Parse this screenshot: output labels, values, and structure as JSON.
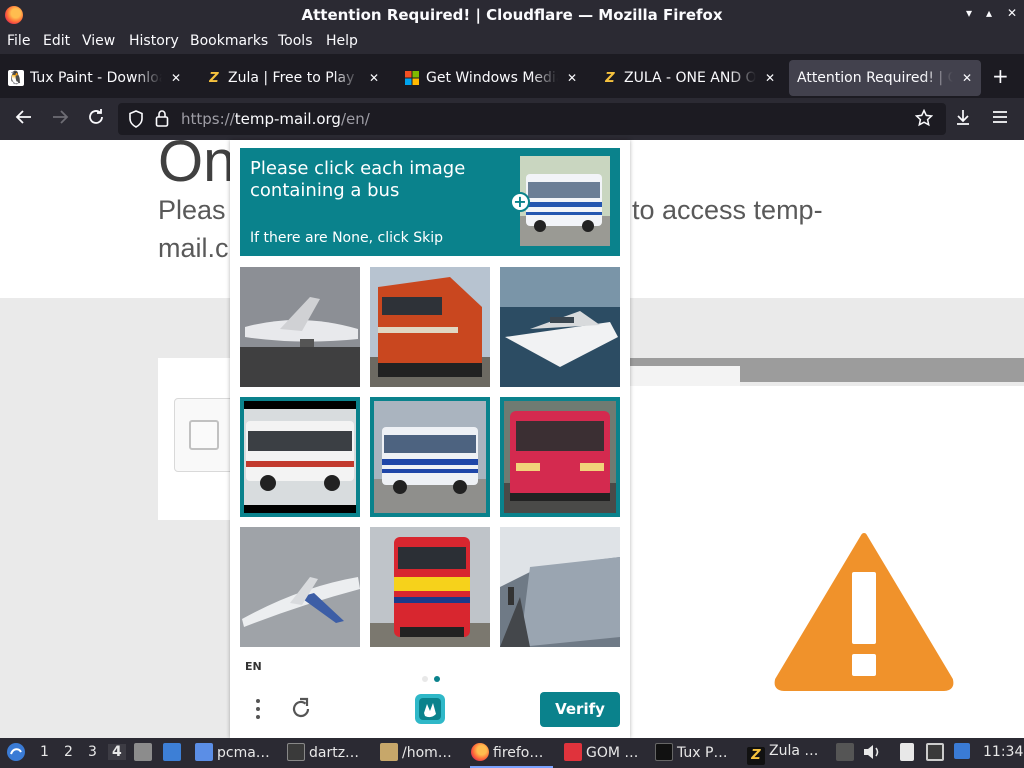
{
  "window": {
    "title": "Attention Required! | Cloudflare — Mozilla Firefox",
    "controls": [
      "▾",
      "▴",
      "✕"
    ]
  },
  "menu": [
    "File",
    "Edit",
    "View",
    "History",
    "Bookmarks",
    "Tools",
    "Help"
  ],
  "tabs": [
    {
      "label": "Tux Paint - Download",
      "icon": "tux-icon",
      "active": false
    },
    {
      "label": "Zula | Free to Play FPS",
      "icon": "zula-icon",
      "active": false
    },
    {
      "label": "Get Windows Media Player",
      "icon": "windows-icon",
      "active": false
    },
    {
      "label": "ZULA - ONE AND ONLY",
      "icon": "zula-icon",
      "active": false
    },
    {
      "label": "Attention Required! | Cloudflare",
      "icon": "none",
      "active": true
    }
  ],
  "newtab_label": "+",
  "address": {
    "prefix": "https://",
    "domain": "temp-mail.org",
    "path": "/en/"
  },
  "page": {
    "heading": "On",
    "sub_left_1": "Pleas",
    "sub_right_1": "to access temp-",
    "sub_left_2": "mail.c"
  },
  "captcha": {
    "prompt": "Please click each image containing a bus",
    "hint": "If there are None, click Skip",
    "plus": "+",
    "tiles": [
      {
        "subject": "airplane",
        "selected": false
      },
      {
        "subject": "train",
        "selected": false
      },
      {
        "subject": "boat",
        "selected": false
      },
      {
        "subject": "bus",
        "selected": true
      },
      {
        "subject": "bus",
        "selected": true
      },
      {
        "subject": "bus",
        "selected": true
      },
      {
        "subject": "airplane",
        "selected": false
      },
      {
        "subject": "train",
        "selected": false
      },
      {
        "subject": "train",
        "selected": false
      }
    ],
    "lang": "EN",
    "verify_label": "Verify",
    "accent": "#0a828c"
  },
  "taskbar": {
    "workspaces": [
      "1",
      "2",
      "3",
      "4"
    ],
    "current_workspace": "4",
    "items": [
      {
        "label": "pcma…",
        "icon": "folder-icon"
      },
      {
        "label": "dartz…",
        "icon": "terminal-icon"
      },
      {
        "label": "/hom…",
        "icon": "archive-icon"
      },
      {
        "label": "firefo…",
        "icon": "firefox-icon"
      },
      {
        "label": "GOM …",
        "icon": "gom-icon"
      },
      {
        "label": "Tux P…",
        "icon": "tux-icon"
      },
      {
        "label": "Zula …",
        "icon": "zula-icon"
      }
    ],
    "clock": "11:34"
  }
}
